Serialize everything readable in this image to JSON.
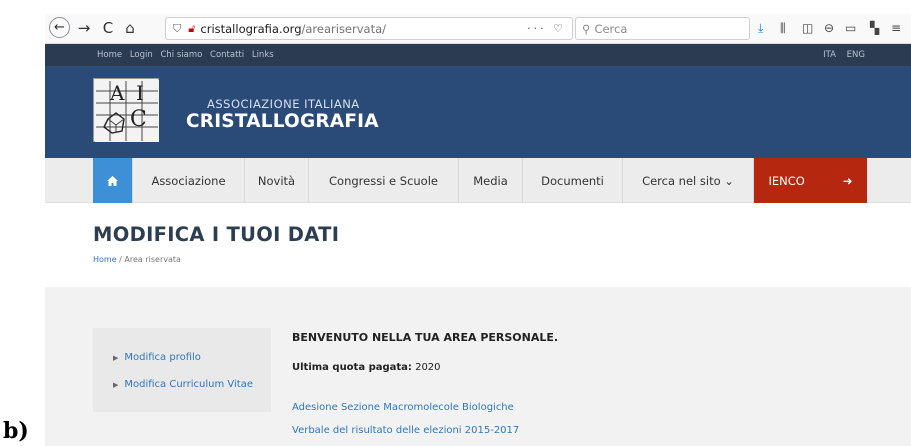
{
  "browser": {
    "url_domain": "cristallografia.org",
    "url_path": "/areariservata/",
    "url_actions": "··· ♡",
    "search_placeholder": "Cerca",
    "back_glyph": "←",
    "forward_glyph": "→",
    "reload_glyph": "C",
    "home_glyph": "⌂"
  },
  "topbar": {
    "links": [
      "Home",
      "Login",
      "Chi siamo",
      "Contatti",
      "Links"
    ],
    "lang": [
      "ITA",
      "ENG"
    ]
  },
  "header": {
    "subtitle": "ASSOCIAZIONE ITALIANA",
    "title": "CRISTALLOGRAFIA",
    "logo_letters": [
      "A",
      "I",
      "C"
    ]
  },
  "nav": {
    "home_icon": "home-icon",
    "items": [
      "Associazione",
      "Novità",
      "Congressi e Scuole",
      "Media",
      "Documenti",
      "Cerca nel sito ⌄"
    ],
    "ienco_label": "IENCO",
    "exit_glyph": "➜"
  },
  "page": {
    "title": "MODIFICA I TUOI DATI",
    "breadcrumb_home": "Home",
    "breadcrumb_sep": " / ",
    "breadcrumb_current": "Area riservata"
  },
  "sidebar": {
    "items": [
      "Modifica profilo",
      "Modifica Curriculum Vitae"
    ]
  },
  "main": {
    "welcome": "BENVENUTO NELLA TUA AREA PERSONALE.",
    "quota_label": "Ultima quota pagata:",
    "quota_value": " 2020",
    "links": [
      "Adesione Sezione Macromolecole Biologiche",
      "Verbale del risultato delle elezioni 2015-2017"
    ]
  },
  "figure_label": "b)",
  "colors": {
    "header_bg": "#2a4a78",
    "topstrip_bg": "#2a3b52",
    "nav_home": "#3d8fd6",
    "ienco_bg": "#b5280f",
    "link": "#2f76b9"
  }
}
